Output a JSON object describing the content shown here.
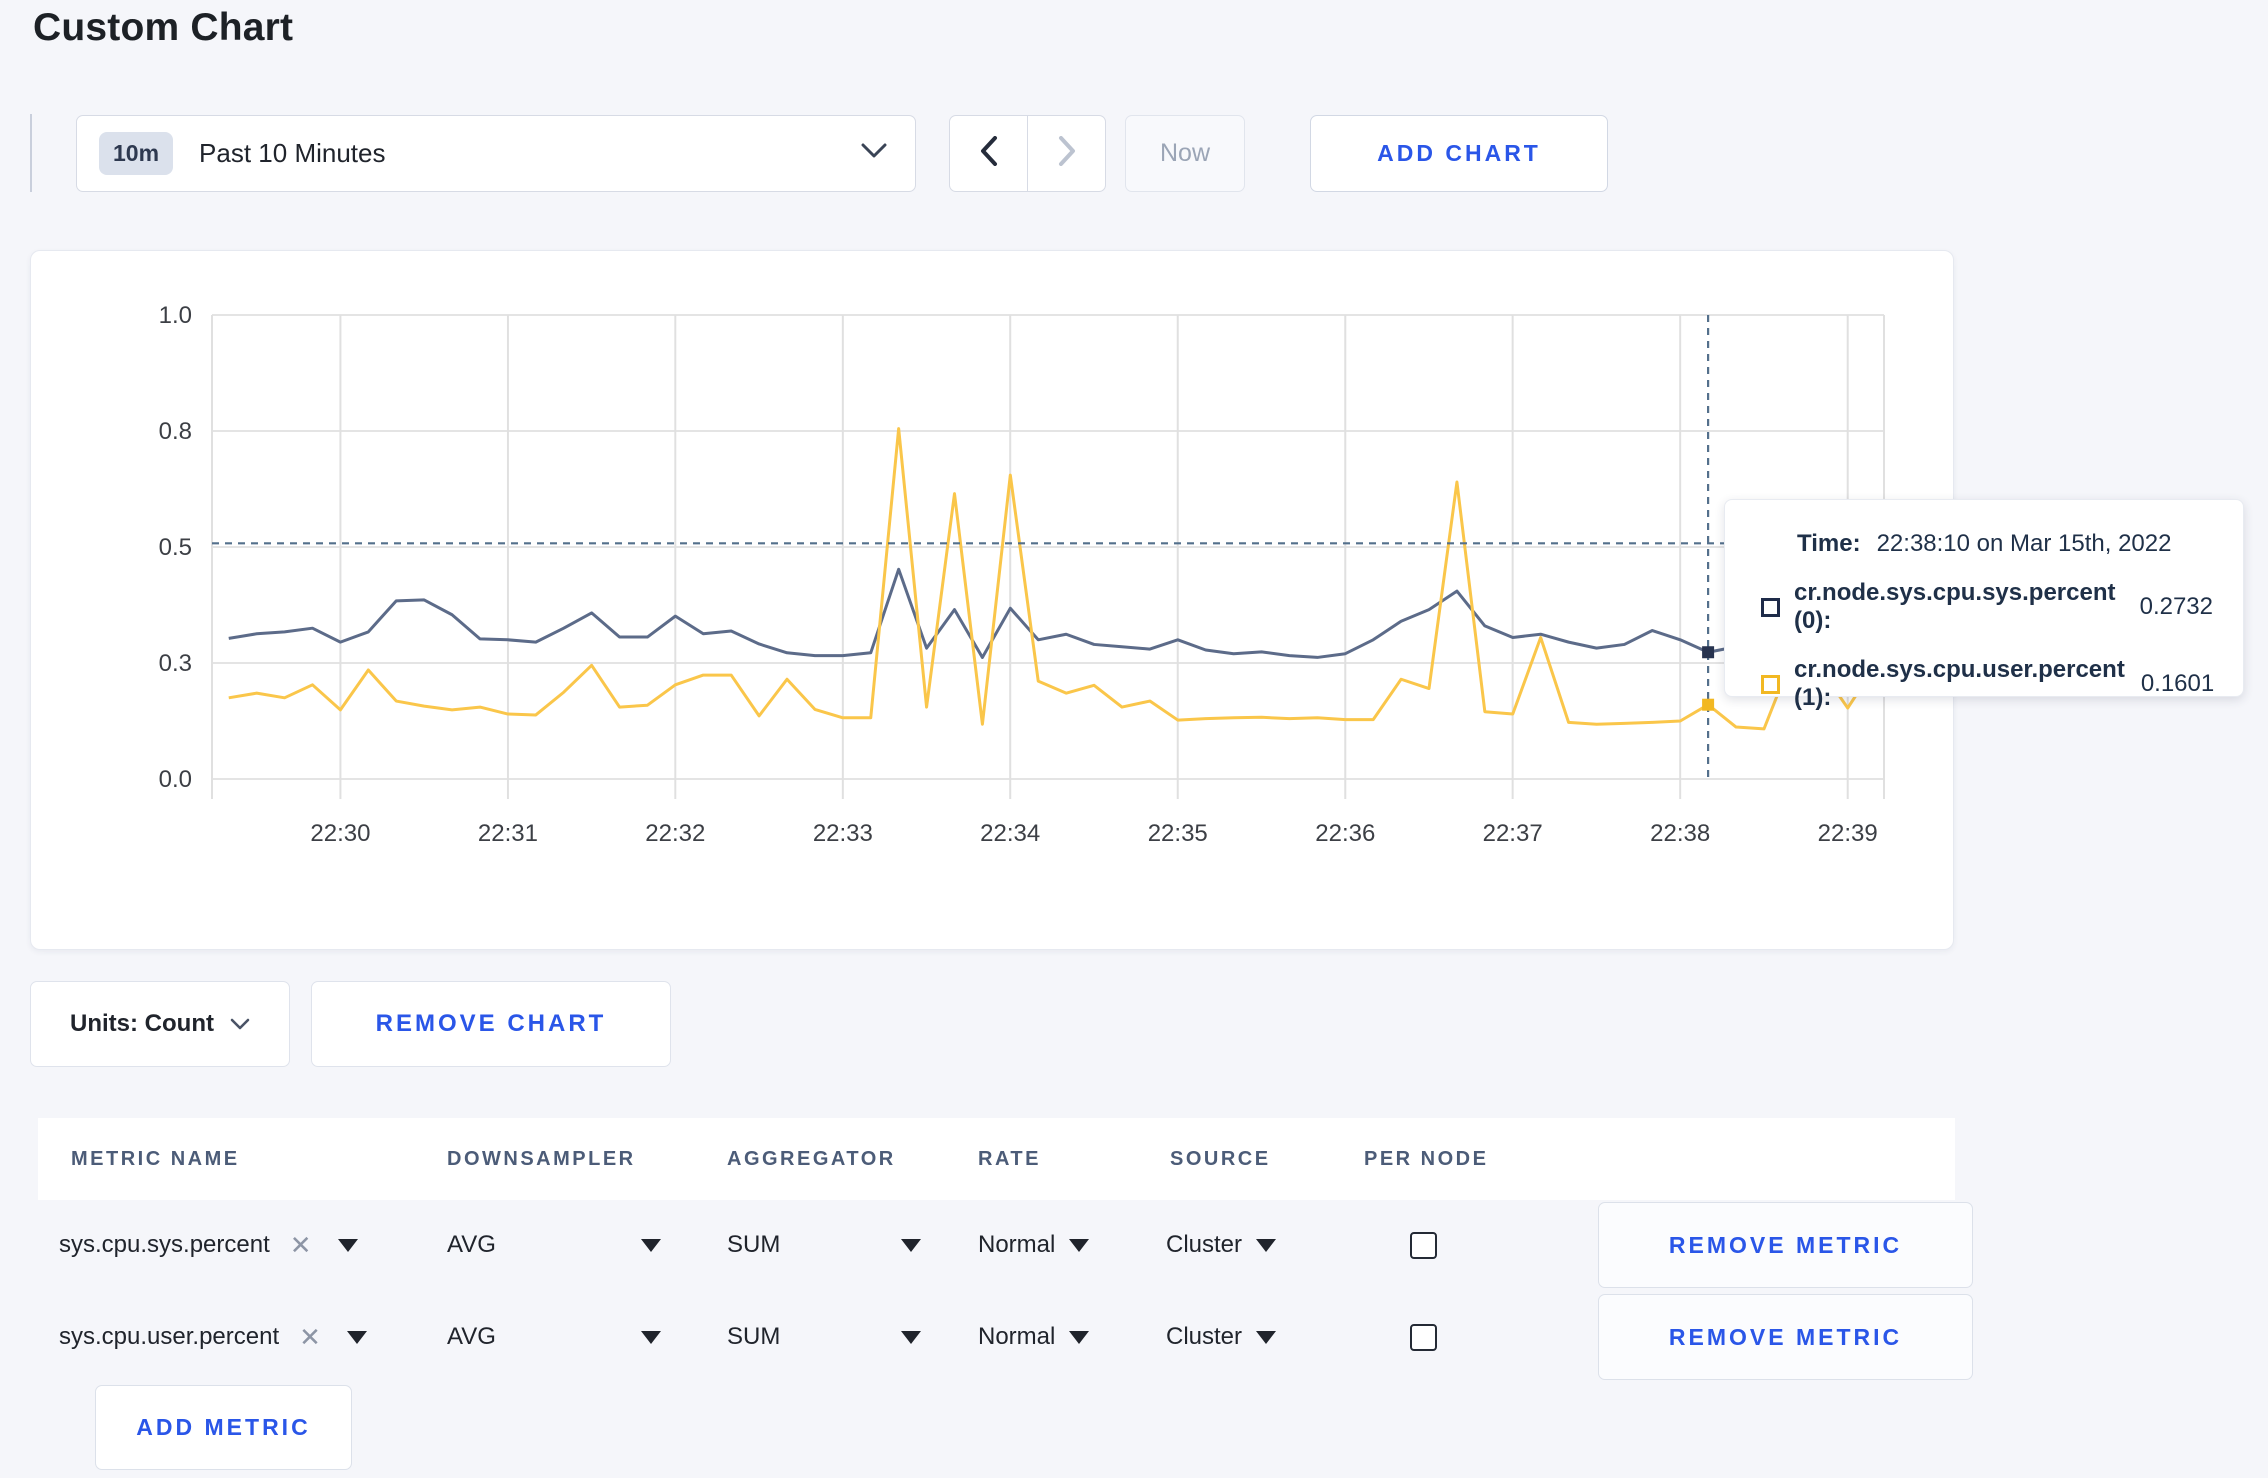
{
  "page": {
    "title": "Custom Chart"
  },
  "toolbar": {
    "time_window_badge": "10m",
    "time_window_label": "Past 10 Minutes",
    "prev_icon": "chevron-left",
    "next_icon": "chevron-right",
    "now_label": "Now",
    "add_chart_label": "ADD CHART"
  },
  "tooltip": {
    "time_label": "Time:",
    "time_value": "22:38:10 on Mar 15th, 2022",
    "series": [
      {
        "label": "cr.node.sys.cpu.sys.percent (0):",
        "value": "0.2732",
        "swatch_color": "#1e2b49"
      },
      {
        "label": "cr.node.sys.cpu.user.percent (1):",
        "value": "0.1601",
        "swatch_color": "#f2b822"
      }
    ]
  },
  "units_row": {
    "units_label": "Units: Count",
    "remove_chart_label": "REMOVE CHART"
  },
  "metrics_table": {
    "headers": [
      "METRIC NAME",
      "DOWNSAMPLER",
      "AGGREGATOR",
      "RATE",
      "SOURCE",
      "PER NODE"
    ],
    "rows": [
      {
        "metric_name": "sys.cpu.sys.percent",
        "downsampler": "AVG",
        "aggregator": "SUM",
        "rate": "Normal",
        "source": "Cluster",
        "per_node_checked": false,
        "remove_label": "REMOVE METRIC"
      },
      {
        "metric_name": "sys.cpu.user.percent",
        "downsampler": "AVG",
        "aggregator": "SUM",
        "rate": "Normal",
        "source": "Cluster",
        "per_node_checked": false,
        "remove_label": "REMOVE METRIC"
      }
    ],
    "add_metric_label": "ADD METRIC"
  },
  "colors": {
    "accent_blue": "#2a56e8",
    "page_background": "#f5f6fa",
    "crosshair": "#54708c"
  },
  "chart_data": {
    "type": "line",
    "title": "",
    "xlabel": "",
    "ylabel": "",
    "ylim": [
      0,
      1
    ],
    "grid": true,
    "legend_position": "tooltip-only",
    "x_start": "22:29:20",
    "x_interval_seconds": 10,
    "x_window_seconds": 599,
    "x_first_point_offset_seconds": 6,
    "x_ticks": [
      {
        "label": "22:30",
        "frac": 0.0768
      },
      {
        "label": "22:31",
        "frac": 0.177
      },
      {
        "label": "22:32",
        "frac": 0.2771
      },
      {
        "label": "22:33",
        "frac": 0.3773
      },
      {
        "label": "22:34",
        "frac": 0.4774
      },
      {
        "label": "22:35",
        "frac": 0.5776
      },
      {
        "label": "22:36",
        "frac": 0.6778
      },
      {
        "label": "22:37",
        "frac": 0.7779
      },
      {
        "label": "22:38",
        "frac": 0.8781
      },
      {
        "label": "22:39",
        "frac": 0.9783
      }
    ],
    "y_ticks": [
      {
        "label": "0.0",
        "value": 0.0
      },
      {
        "label": "0.3",
        "value": 0.25
      },
      {
        "label": "0.5",
        "value": 0.5
      },
      {
        "label": "0.8",
        "value": 0.75
      },
      {
        "label": "1.0",
        "value": 1.0
      }
    ],
    "crosshair": {
      "time": "22:38:10",
      "x_frac": 0.8948,
      "hline_value": 0.508,
      "hover_values": [
        0.2732,
        0.1601
      ]
    },
    "series": [
      {
        "name": "cr.node.sys.cpu.sys.percent",
        "color": "#5c6b89",
        "dot_color": "#27334f",
        "values": [
          0.303,
          0.313,
          0.317,
          0.325,
          0.295,
          0.317,
          0.384,
          0.386,
          0.354,
          0.302,
          0.3,
          0.295,
          0.325,
          0.358,
          0.306,
          0.306,
          0.351,
          0.313,
          0.319,
          0.291,
          0.272,
          0.266,
          0.266,
          0.272,
          0.452,
          0.282,
          0.365,
          0.262,
          0.368,
          0.3,
          0.312,
          0.29,
          0.285,
          0.28,
          0.3,
          0.278,
          0.27,
          0.274,
          0.266,
          0.262,
          0.27,
          0.3,
          0.34,
          0.365,
          0.405,
          0.33,
          0.305,
          0.312,
          0.295,
          0.282,
          0.29,
          0.32,
          0.3,
          0.2732,
          0.285,
          0.27,
          0.278,
          0.285,
          0.28,
          0.3
        ]
      },
      {
        "name": "cr.node.sys.cpu.user.percent",
        "color": "#fac64a",
        "dot_color": "#f2b822",
        "values": [
          0.175,
          0.185,
          0.175,
          0.203,
          0.149,
          0.235,
          0.168,
          0.157,
          0.149,
          0.155,
          0.14,
          0.138,
          0.187,
          0.245,
          0.155,
          0.159,
          0.203,
          0.224,
          0.224,
          0.136,
          0.215,
          0.15,
          0.132,
          0.132,
          0.755,
          0.155,
          0.615,
          0.118,
          0.655,
          0.211,
          0.185,
          0.202,
          0.155,
          0.168,
          0.127,
          0.13,
          0.132,
          0.133,
          0.13,
          0.132,
          0.128,
          0.128,
          0.215,
          0.195,
          0.64,
          0.145,
          0.14,
          0.305,
          0.122,
          0.118,
          0.12,
          0.122,
          0.125,
          0.1601,
          0.112,
          0.108,
          0.26,
          0.24,
          0.153,
          0.245
        ]
      }
    ]
  }
}
